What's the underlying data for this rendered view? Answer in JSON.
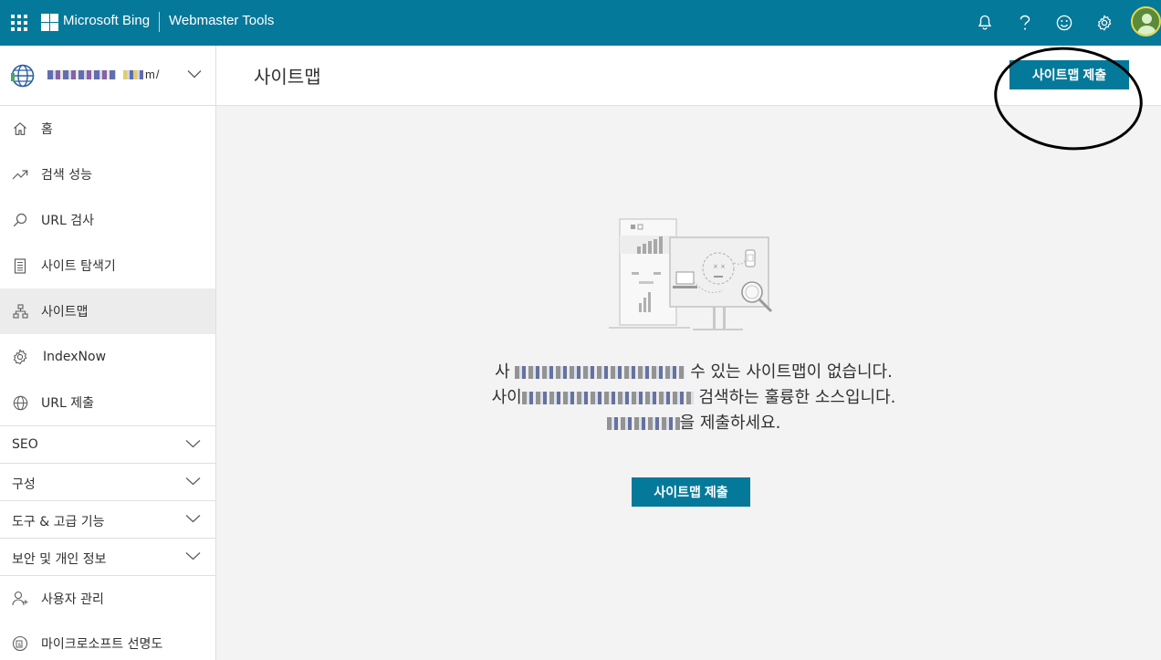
{
  "topbar": {
    "brand": "Microsoft Bing",
    "product": "Webmaster Tools"
  },
  "sidebar": {
    "site_url_suffix": "m/",
    "items": [
      {
        "label": "홈",
        "icon": "home-icon"
      },
      {
        "label": "검색 성능",
        "icon": "trend-up-icon"
      },
      {
        "label": "URL 검사",
        "icon": "search-icon"
      },
      {
        "label": "사이트 탐색기",
        "icon": "document-list-icon"
      },
      {
        "label": "사이트맵",
        "icon": "sitemap-icon",
        "active": true
      },
      {
        "label": "IndexNow",
        "icon": "gear-icon"
      },
      {
        "label": "URL 제출",
        "icon": "globe-icon"
      }
    ],
    "groups": [
      {
        "label": "SEO"
      },
      {
        "label": "구성"
      },
      {
        "label": "도구 & 고급 기능"
      },
      {
        "label": "보안 및 개인 정보"
      }
    ],
    "bottom_items": [
      {
        "label": "사용자 관리",
        "icon": "user-icon"
      },
      {
        "label": "마이크로소프트 선명도",
        "icon": "clarity-icon"
      }
    ]
  },
  "main": {
    "title": "사이트맵",
    "submit_button": "사이트맵 제출",
    "empty_line1_end": "수 있는 사이트맵이 없습니다.",
    "empty_line1_start": "사",
    "empty_line2_start": "사이",
    "empty_line2_end": "검색하는 훌륭한 소스입니다.",
    "empty_line3_end": "을 제출하세요.",
    "empty_button": "사이트맵 제출"
  },
  "colors": {
    "accent": "#05799a"
  }
}
